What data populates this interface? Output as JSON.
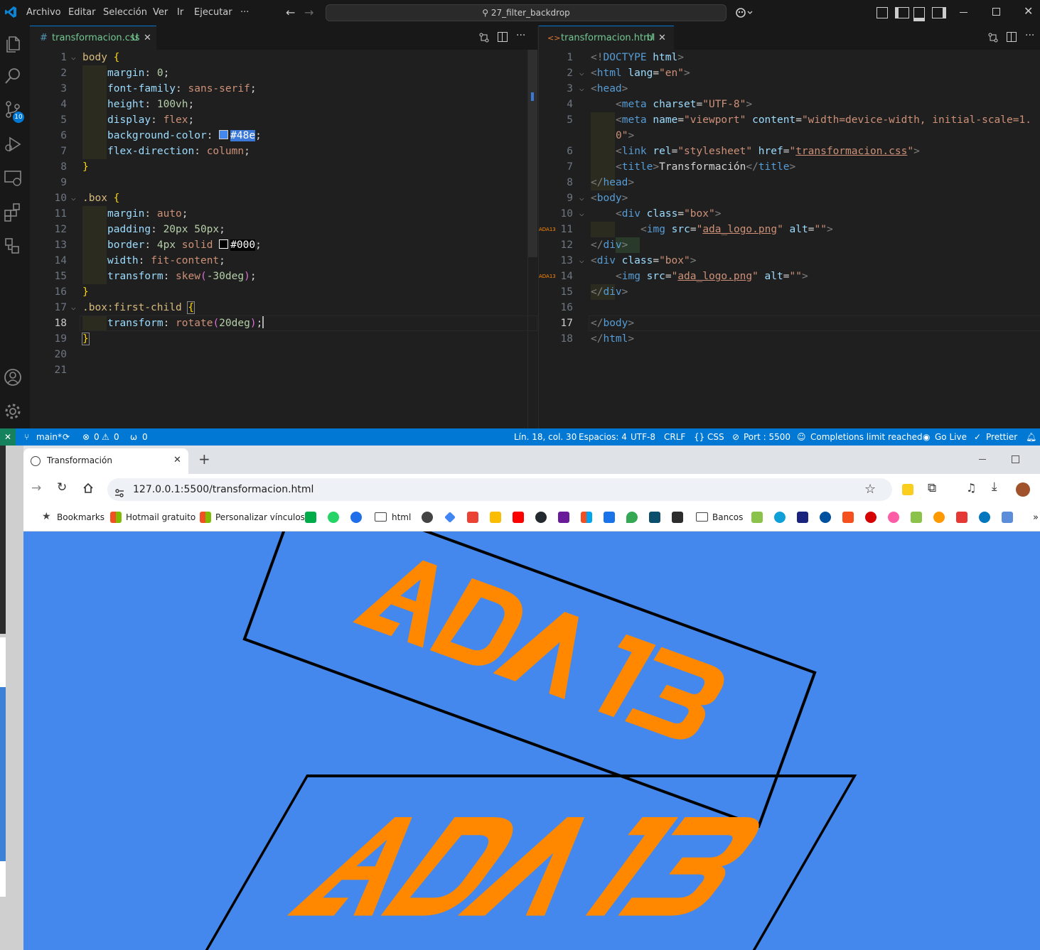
{
  "vscode": {
    "menu": [
      "Archivo",
      "Editar",
      "Selección",
      "Ver",
      "Ir",
      "Ejecutar",
      "···"
    ],
    "search": "27_filter_backdrop",
    "source_control_badge": "10",
    "left_tab": {
      "icon": "#",
      "name": "transformacion.css",
      "status": "U"
    },
    "right_tab": {
      "icon": "<>",
      "name": "transformacion.html",
      "status": "U"
    },
    "css_lines": [
      "1",
      "2",
      "3",
      "4",
      "5",
      "6",
      "7",
      "8",
      "9",
      "10",
      "11",
      "12",
      "13",
      "14",
      "15",
      "16",
      "17",
      "18",
      "19",
      "20",
      "21"
    ],
    "html_lines": [
      "1",
      "2",
      "3",
      "4",
      "5",
      "",
      "6",
      "7",
      "8",
      "9",
      "10",
      "11",
      "12",
      "13",
      "14",
      "15",
      "16",
      "17",
      "18"
    ],
    "css": {
      "l1": [
        "body",
        "{"
      ],
      "l2": [
        "margin",
        ": ",
        "0",
        ";"
      ],
      "l3": [
        "font-family",
        ": ",
        "sans-serif",
        ";"
      ],
      "l4": [
        "height",
        ": ",
        "100vh",
        ";"
      ],
      "l5": [
        "display",
        ": ",
        "flex",
        ";"
      ],
      "l6": [
        "background-color",
        ": ",
        "#48e",
        ";"
      ],
      "l7": [
        "flex-direction",
        ": ",
        "column",
        ";"
      ],
      "l8": [
        "}"
      ],
      "l10": [
        ".box",
        "{"
      ],
      "l11": [
        "margin",
        ": ",
        "auto",
        ";"
      ],
      "l12": [
        "padding",
        ": ",
        "20px 50px",
        ";"
      ],
      "l13": [
        "border",
        ": ",
        "4px",
        "solid",
        "#000",
        ";"
      ],
      "l14": [
        "width",
        ": ",
        "fit-content",
        ";"
      ],
      "l15": [
        "transform",
        ": ",
        "skew",
        "(",
        "-30deg",
        ")",
        ";"
      ],
      "l16": [
        "}"
      ],
      "l17": [
        ".box:first-child",
        "{"
      ],
      "l18": [
        "transform",
        ": ",
        "rotate",
        "(",
        "20deg",
        ")",
        ";"
      ],
      "l19": [
        "}"
      ]
    },
    "html": {
      "h1": [
        "<!",
        "DOCTYPE",
        " html",
        ">"
      ],
      "h2": [
        "<",
        "html",
        " lang",
        "=",
        "\"en\"",
        ">"
      ],
      "h3": [
        "<",
        "head",
        ">"
      ],
      "h4": [
        "<",
        "meta",
        " charset",
        "=",
        "\"UTF-8\"",
        ">"
      ],
      "h5": [
        "<",
        "meta",
        " name",
        "=",
        "\"viewport\"",
        " content",
        "=",
        "\"width=device-width, initial-scale=1."
      ],
      "h5b": [
        "0\"",
        ">"
      ],
      "h6": [
        "<",
        "link",
        " rel",
        "=",
        "\"stylesheet\"",
        " href",
        "=",
        "\"",
        "transformacion.css",
        "\"",
        ">"
      ],
      "h7": [
        "<",
        "title",
        ">",
        "Transformación",
        "</",
        "title",
        ">"
      ],
      "h8": [
        "</",
        "head",
        ">"
      ],
      "h9": [
        "<",
        "body",
        ">"
      ],
      "h10": [
        "<",
        "div",
        " class",
        "=",
        "\"box\"",
        ">"
      ],
      "h11": [
        "<",
        "img",
        " src",
        "=",
        "\"",
        "ada_logo.png",
        "\"",
        " alt",
        "=",
        "\"\"",
        ">"
      ],
      "h12": [
        "</",
        "div",
        ">"
      ],
      "h13": [
        "<",
        "div",
        " class",
        "=",
        "\"box\"",
        ">"
      ],
      "h14": [
        "<",
        "img",
        " src",
        "=",
        "\"",
        "ada_logo.png",
        "\"",
        " alt",
        "=",
        "\"\"",
        ">"
      ],
      "h15": [
        "</",
        "div",
        ">"
      ],
      "h17": [
        "</",
        "body",
        ">"
      ],
      "h18": [
        "</",
        "html",
        ">"
      ]
    },
    "gutter_thumb": "ADA13",
    "status": {
      "branch": "main*",
      "problems": "0",
      "warnings": "0",
      "ports": "0",
      "position": "Lín. 18, col. 30",
      "spaces": "Espacios: 4",
      "encoding": "UTF-8",
      "eol": "CRLF",
      "language": "CSS",
      "port": "Port : 5500",
      "completions": "Completions limit reached",
      "golive": "Go Live",
      "prettier": "Prettier"
    }
  },
  "browser": {
    "tab_title": "Transformación",
    "url": "127.0.0.1:5500/transformacion.html",
    "bookmarks": [
      "Bookmarks",
      "Hotmail gratuito",
      "Personalizar vínculos",
      "html",
      "Bancos"
    ],
    "logo_text": "ADA 13",
    "colors": {
      "page_bg": "#4488ee",
      "logo": "#ff8800",
      "border": "#000000"
    }
  }
}
